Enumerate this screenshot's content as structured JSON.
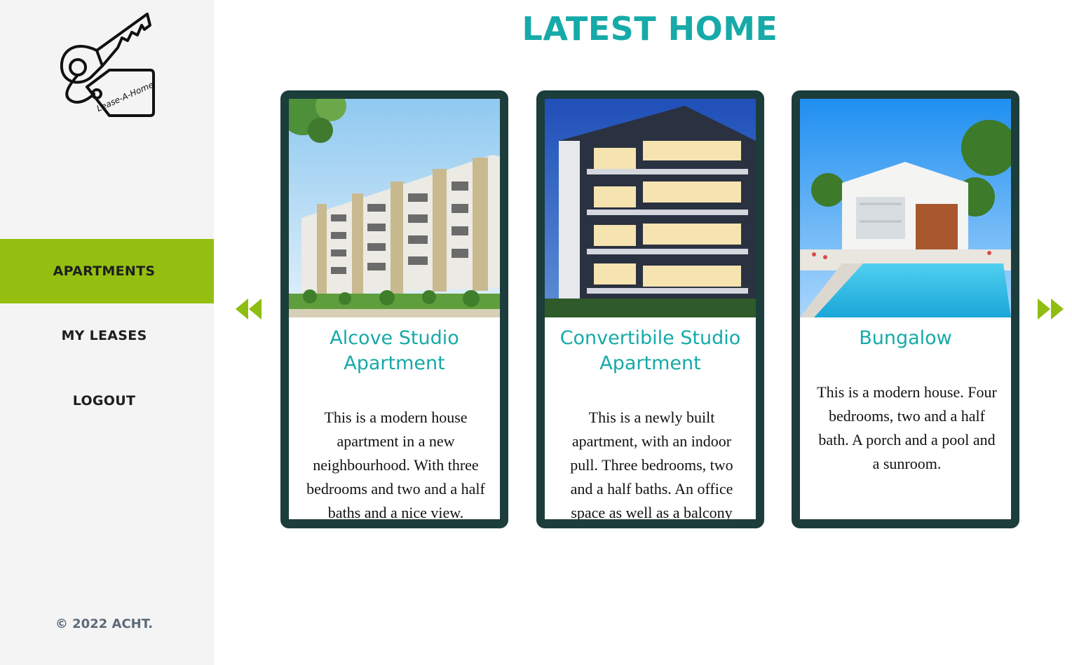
{
  "logo": {
    "text": "Lease-A-Home"
  },
  "nav": {
    "items": [
      {
        "label": "APARTMENTS",
        "active": true
      },
      {
        "label": "MY LEASES",
        "active": false
      },
      {
        "label": "LOGOUT",
        "active": false
      }
    ]
  },
  "footer": {
    "text": "© 2022 ACHT."
  },
  "main": {
    "title": "LATEST HOME",
    "cards": [
      {
        "title": "Alcove Studio Apartment",
        "description": "This is a modern house apartment in a new neighbourhood. With three bedrooms and two and a half baths and a nice view."
      },
      {
        "title": "Convertibile Studio Apartment",
        "description": "This is a newly built apartment, with an indoor pull. Three bedrooms, two and a half baths. An office space as well as a balcony"
      },
      {
        "title": "Bungalow",
        "description": "This is a modern house. Four bedrooms, two and a half bath. A porch and a pool and a sunroom."
      }
    ]
  },
  "colors": {
    "accent_teal": "#16aaa8",
    "nav_active": "#94bf10",
    "card_border": "#1c3d3b",
    "arrow": "#8fbd12",
    "sidebar_bg": "#f4f4f4"
  },
  "icons": {
    "logo": "key-tag-icon",
    "prev": "double-chevron-left-icon",
    "next": "double-chevron-right-icon"
  }
}
